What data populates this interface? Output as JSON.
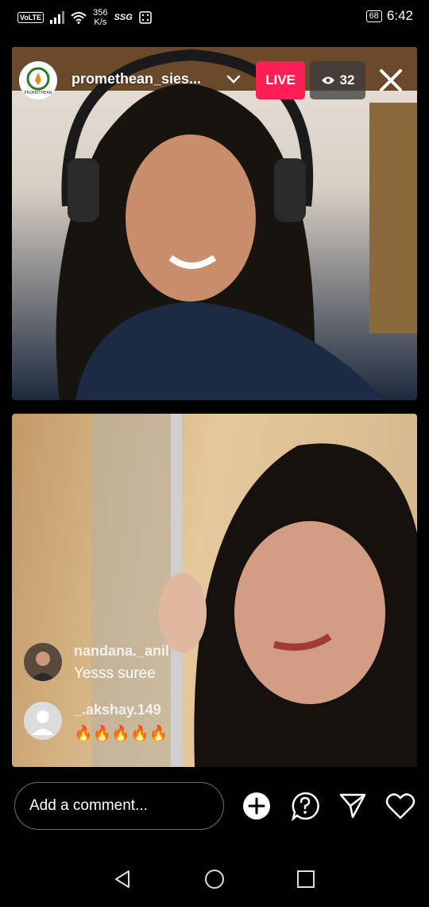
{
  "status_bar": {
    "volte": "VoLTE",
    "network_speed_value": "356",
    "network_speed_unit": "K/s",
    "network_type": "SSG",
    "battery": "68",
    "time": "6:42"
  },
  "live": {
    "host_username": "promethean_sies...",
    "live_label": "LIVE",
    "viewer_count": "32",
    "logo_text": "PROMETHEAN"
  },
  "comments": [
    {
      "username": "nandana._anil",
      "text": "Yesss suree"
    },
    {
      "username": "_.akshay.149",
      "text": "🔥🔥🔥🔥🔥"
    }
  ],
  "comment_box": {
    "placeholder": "Add a comment..."
  },
  "colors": {
    "live_badge": "#ff1f55",
    "viewer_badge": "#3c3c3c",
    "background": "#000000"
  },
  "icons": {
    "top": [
      "chevron-down-icon",
      "eye-icon",
      "close-icon"
    ],
    "actions": [
      "add-icon",
      "question-icon",
      "send-icon",
      "heart-icon"
    ],
    "nav": [
      "back-icon",
      "home-icon",
      "recents-icon"
    ]
  }
}
